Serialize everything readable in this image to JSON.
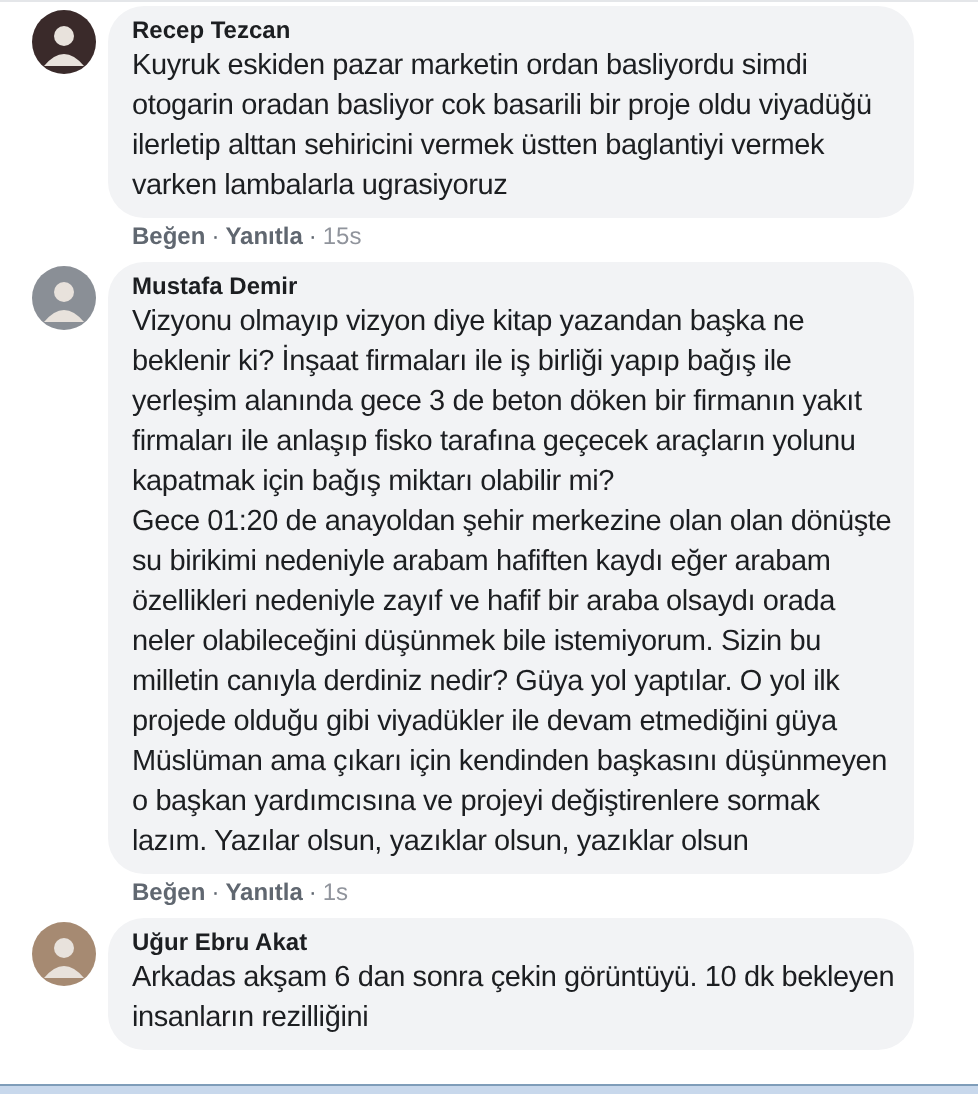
{
  "comments": [
    {
      "author": "Recep Tezcan",
      "paragraphs": [
        "Kuyruk eskiden pazar marketin ordan basliyordu simdi otogarin oradan basliyor cok basarili bir proje oldu viyadüğü ilerletip alttan sehiricini vermek üstten baglantiyi vermek varken lambalarla ugrasiyoruz"
      ],
      "like": "Beğen",
      "separator": "·",
      "reply": "Yanıtla",
      "time": "15s"
    },
    {
      "author": "Mustafa Demir",
      "paragraphs": [
        "Vizyonu olmayıp vizyon diye kitap yazandan başka ne beklenir ki? İnşaat firmaları ile iş birliği yapıp bağış ile yerleşim alanında gece 3 de beton döken bir firmanın yakıt firmaları ile anlaşıp fisko tarafına geçecek araçların yolunu kapatmak için bağış miktarı olabilir mi?",
        "Gece 01:20 de anayoldan şehir merkezine olan olan dönüşte su birikimi nedeniyle arabam hafiften kaydı eğer arabam özellikleri nedeniyle zayıf ve hafif bir araba olsaydı orada neler olabileceğini düşünmek bile istemiyorum. Sizin bu milletin canıyla derdiniz nedir? Güya yol yaptılar. O yol ilk projede olduğu gibi viyadükler ile devam etmediğini güya Müslüman ama çıkarı için kendinden başkasını düşünmeyen o başkan yardımcısına ve projeyi değiştirenlere sormak lazım. Yazılar olsun, yazıklar olsun, yazıklar olsun"
      ],
      "like": "Beğen",
      "separator": "·",
      "reply": "Yanıtla",
      "time": "1s"
    },
    {
      "author": "Uğur Ebru Akat",
      "paragraphs": [
        "Arkadas akşam 6 dan sonra çekin görüntüyü. 10 dk bekleyen insanların rezilliğini"
      ]
    }
  ]
}
